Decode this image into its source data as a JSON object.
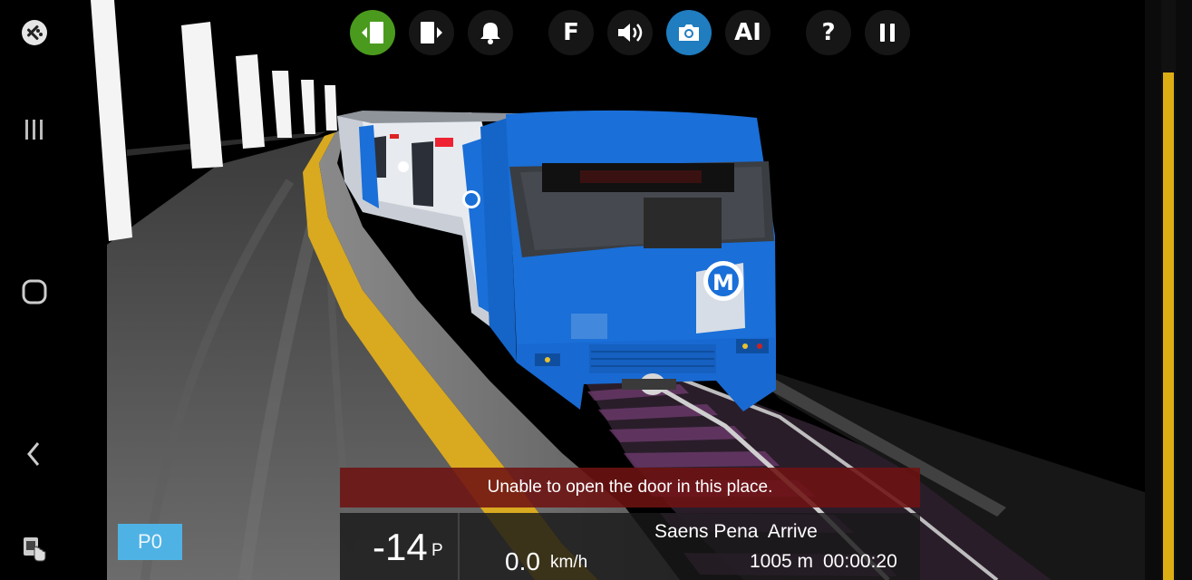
{
  "navbar": {
    "icons": [
      "gamepad-icon",
      "recent-apps-icon",
      "home-icon",
      "back-icon",
      "screen-touch-icon"
    ]
  },
  "toolbar": {
    "buttons": [
      {
        "name": "open-left-door-button",
        "icon": "door-left-icon",
        "label": ""
      },
      {
        "name": "open-right-door-button",
        "icon": "door-right-icon",
        "label": ""
      },
      {
        "name": "bell-button",
        "icon": "bell-icon",
        "label": ""
      },
      {
        "name": "function-button",
        "icon": "",
        "label": "F"
      },
      {
        "name": "sound-button",
        "icon": "speaker-icon",
        "label": ""
      },
      {
        "name": "camera-button",
        "icon": "camera-icon",
        "label": ""
      },
      {
        "name": "ai-button",
        "icon": "",
        "label": "AI"
      },
      {
        "name": "help-button",
        "icon": "",
        "label": "?"
      },
      {
        "name": "pause-button",
        "icon": "pause-icon",
        "label": ""
      }
    ],
    "colors": {
      "door_left_active": "#4a9a1e",
      "camera_active": "#1f7dc0"
    }
  },
  "message": "Unable to open the door in this place.",
  "hud": {
    "mode_badge": "P0",
    "notch_value": "-14",
    "notch_unit": "P",
    "speed_value": "0.0",
    "speed_unit": "km/h",
    "station": "Saens Pena  Arrive",
    "distance": "1005 m",
    "timer": "00:00:20"
  },
  "scene": {
    "train_color": "#1a6fd8",
    "train_logo": "M",
    "platform_tactile_color": "#d9a920"
  }
}
